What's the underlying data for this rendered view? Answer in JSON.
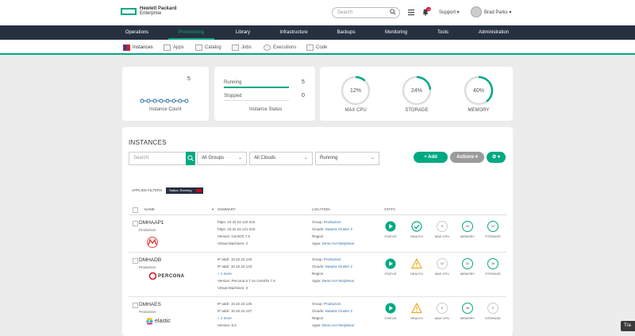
{
  "header": {
    "brand_line1": "Hewlett Packard",
    "brand_line2": "Enterprise",
    "search_placeholder": "Search",
    "notification_count": "13",
    "support_label": "Support",
    "user_name": "Brad Parks"
  },
  "main_nav": [
    "Operations",
    "Provisioning",
    "Library",
    "Infrastructure",
    "Backups",
    "Monitoring",
    "Tools",
    "Administration"
  ],
  "sub_nav": [
    "Instances",
    "Apps",
    "Catalog",
    "Jobs",
    "Executions",
    "Code"
  ],
  "summary": {
    "instance_count": "5",
    "instance_count_label": "Instance Count",
    "running_label": "Running",
    "running_count": "5",
    "stopped_label": "Stopped",
    "stopped_count": "0",
    "status_label": "Instance Status",
    "gauges": [
      {
        "label": "MAX CPU",
        "value": "12%",
        "fraction": 0.12
      },
      {
        "label": "STORAGE",
        "value": "24%",
        "fraction": 0.24
      },
      {
        "label": "MEMORY",
        "value": "40%",
        "fraction": 0.4
      }
    ]
  },
  "instances_panel": {
    "title": "INSTANCES",
    "search_placeholder": "Search",
    "group_filter": "All Groups",
    "cloud_filter": "All Clouds",
    "status_filter": "Running",
    "add_button": "+ Add",
    "actions_button": "Actions",
    "applied_filters_label": "APPLIED FILTERS",
    "applied_filter_chip": "Status: Running",
    "columns": [
      "NAME",
      "SUMMARY",
      "LOCATION",
      "STATS"
    ],
    "stat_labels": [
      "STATUS",
      "HEALTH",
      "MAX CPU",
      "MEMORY",
      "STORAGE"
    ]
  },
  "rows": [
    {
      "name": "DMHAAP1",
      "group": "Production",
      "summary": [
        "https: 10.32.22.122:443",
        "https: 10.32.22.121:443",
        "Version: CentOS 7.5",
        "Virtual Machines: 2"
      ],
      "location_group": "Production",
      "location_cloud": "Nutanix Cluster 2",
      "location_region": "Region",
      "location_app": "Demo HA Morpheus",
      "health": "ok",
      "cpu": "6",
      "memory": "33",
      "storage": "34",
      "logo": "M"
    },
    {
      "name": "DMHADB",
      "group": "Production",
      "summary": [
        "IP addr: 10.32.22.125",
        "IP addr: 10.32.22.123",
        "+ 1 more",
        "Version: Percona 5.7 on CentOS 7.5",
        "Virtual Machines: 3"
      ],
      "location_group": "Production",
      "location_cloud": "Nutanix Cluster 2",
      "location_region": "Region",
      "location_app": "Demo HA Morpheus",
      "health": "warning",
      "cpu": "12",
      "memory": "42",
      "storage": "28",
      "logo": "PERCONA"
    },
    {
      "name": "DMHAES",
      "group": "Production",
      "summary": [
        "IP addr: 10.32.22.126",
        "IP addr: 10.32.22.127",
        "+ 1 more",
        "Version: 5.6"
      ],
      "location_group": "Production",
      "location_cloud": "Nutanix Cluster 2",
      "location_region": "Region",
      "location_app": "Demo HA Morpheus",
      "health": "warning",
      "cpu": "5",
      "memory": "38",
      "storage": "0",
      "logo": "elastic"
    }
  ],
  "corner_text": "Tra",
  "colors": {
    "accent": "#01a982",
    "nav_bg": "#263040",
    "link": "#2f6fa8",
    "warning": "#f5a623"
  }
}
